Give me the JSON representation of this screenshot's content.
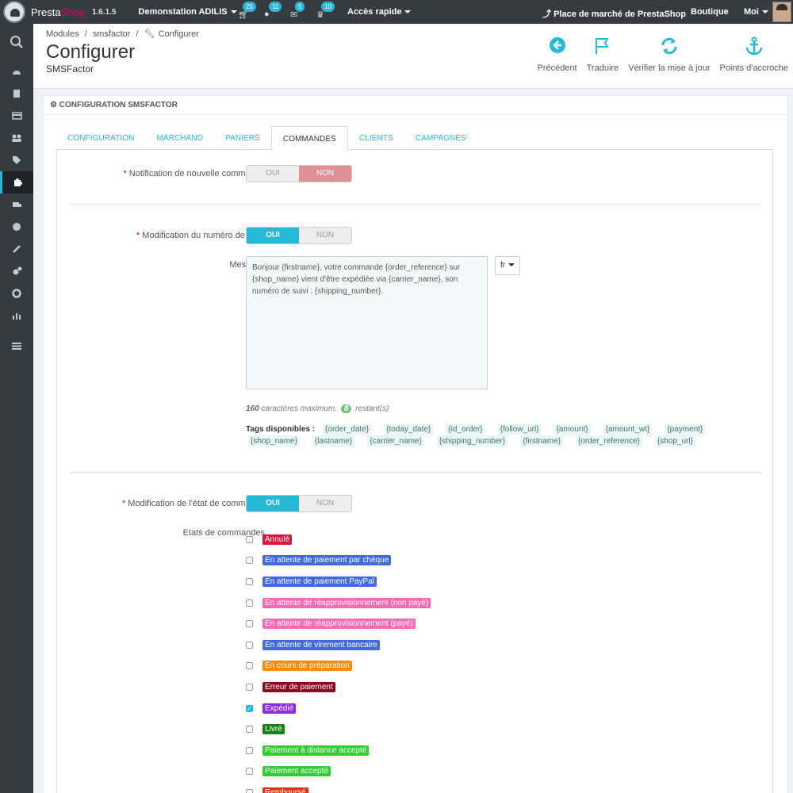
{
  "topbar": {
    "brand_a": "Presta",
    "brand_b": "Shop",
    "version": "1.6.1.5",
    "store": "Demonstation ADILIS",
    "notifications": [
      {
        "icon": "cart-icon",
        "count": "25"
      },
      {
        "icon": "user-icon",
        "count": "11"
      },
      {
        "icon": "envelope-icon",
        "count": "5"
      },
      {
        "icon": "trophy-icon",
        "count": "10"
      }
    ],
    "quick_access": "Accès rapide",
    "marketplace": "Place de marché de PrestaShop",
    "shop": "Boutique",
    "me": "Moi"
  },
  "sidebar": {
    "items": [
      "dashboard-icon",
      "orders-icon",
      "payment-icon",
      "customers-icon",
      "tags-icon",
      "modules-icon",
      "shipping-icon",
      "localization-icon",
      "preferences-icon",
      "advanced-icon",
      "admin-icon",
      "stats-icon",
      "menu-icon"
    ]
  },
  "header": {
    "breadcrumb": [
      "Modules",
      "/",
      "smsfactor",
      "/",
      "Configurer"
    ],
    "title": "Configurer",
    "subtitle": "SMSFactor",
    "toolbar": [
      {
        "icon": "back-circle-icon",
        "label": "Précédent"
      },
      {
        "icon": "flag-icon",
        "label": "Traduire"
      },
      {
        "icon": "refresh-icon",
        "label": "Vérifier la mise à jour"
      },
      {
        "icon": "anchor-icon",
        "label": "Points d'accroche"
      }
    ]
  },
  "panel": {
    "heading": "CONFIGURATION SMSFACTOR",
    "tabs": [
      "CONFIGURATION",
      "MARCHAND",
      "PANIERS",
      "COMMANDES",
      "CLIENTS",
      "CAMPAGNES"
    ],
    "active_tab": "COMMANDES"
  },
  "form": {
    "yes": "OUI",
    "no": "NON",
    "new_order": {
      "label": "Notification de nouvelle commande",
      "value": "NON"
    },
    "tracking": {
      "label": "Modification du numéro de suivi",
      "value": "OUI"
    },
    "message_label": "Message",
    "message": "Bonjour {firstname}, votre commande {order_reference} sur {shop_name} vient d'être expédiée via {carrier_name}, son numéro de suivi : {shipping_number}.",
    "lang": "fr",
    "max_text": "160",
    "max_suffix": "caractères maximum.",
    "remaining": "8",
    "remaining_suffix": "restant(s)",
    "tags_label": "Tags disponibles :",
    "tags": [
      "{order_date}",
      "{today_date}",
      "{id_order}",
      "{follow_url}",
      "{amount}",
      "{amount_wt}",
      "{payment}",
      "{shop_name}",
      "{lastname}",
      "{carrier_name}",
      "{shipping_number}",
      "{firstname}",
      "{order_reference}",
      "{shop_url}"
    ],
    "state_change": {
      "label": "Modification de l'état de commande",
      "value": "OUI"
    },
    "states_label": "Etats de commandes",
    "states": [
      {
        "label": "Annulé",
        "color": "#dc143c",
        "checked": false
      },
      {
        "label": "En attente de paiement par chèque",
        "color": "#4169e1",
        "checked": false
      },
      {
        "label": "En attente de paiement PayPal",
        "color": "#4169e1",
        "checked": false
      },
      {
        "label": "En attente de réapprovisionnement (non payé)",
        "color": "#ff69b4",
        "checked": false
      },
      {
        "label": "En attente de réapprovisionnement (payé)",
        "color": "#ff69b4",
        "checked": false
      },
      {
        "label": "En attente de virement bancaire",
        "color": "#4169e1",
        "checked": false
      },
      {
        "label": "En cours de préparation",
        "color": "#ff8c00",
        "checked": false
      },
      {
        "label": "Erreur de paiement",
        "color": "#8f0621",
        "checked": false
      },
      {
        "label": "Expédié",
        "color": "#8a2be2",
        "checked": true
      },
      {
        "label": "Livré",
        "color": "#108510",
        "checked": false
      },
      {
        "label": "Paiement à distance accepté",
        "color": "#32cd32",
        "checked": false
      },
      {
        "label": "Paiement accepté",
        "color": "#32cd32",
        "checked": false
      },
      {
        "label": "Remboursé",
        "color": "#ec2e15",
        "checked": false
      }
    ]
  }
}
